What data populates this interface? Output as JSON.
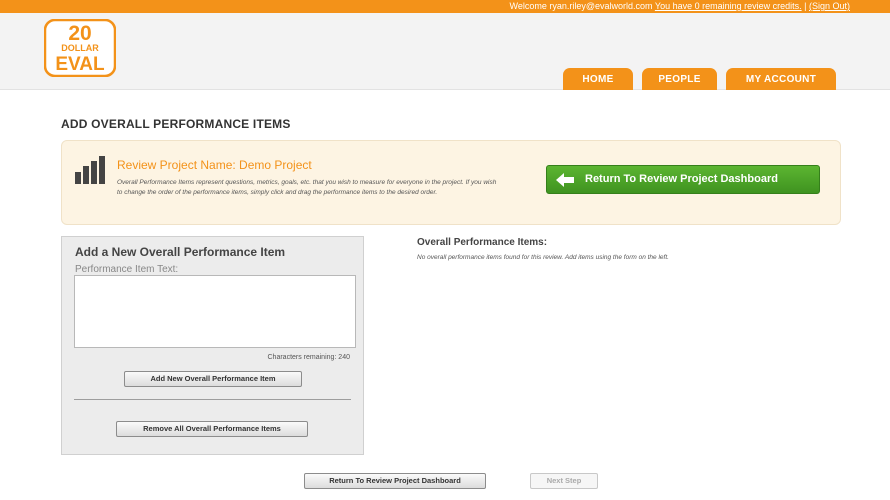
{
  "topbar": {
    "welcome_text": "Welcome ryan.riley@evalworld.com",
    "credits_link": "You have  0  remaining review credits.",
    "separator": " | ",
    "signout_link": "(Sign Out)"
  },
  "logo": {
    "line1": "20",
    "line2": "DOLLAR",
    "line3": "EVAL"
  },
  "nav": {
    "home": "HOME",
    "people": "PEOPLE",
    "account": "MY ACCOUNT"
  },
  "page": {
    "title": "ADD OVERALL PERFORMANCE ITEMS"
  },
  "project": {
    "name": "Review Project Name: Demo Project",
    "description": "Overall Performance Items represent questions, metrics, goals, etc. that you wish to measure for everyone in the project. If you wish to change the order of the performance items, simply click and drag the performance items to the desired order.",
    "return_button": "Return To Review Project Dashboard"
  },
  "form": {
    "title": "Add a New Overall Performance Item",
    "label": "Performance Item Text:",
    "value": "",
    "chars_remaining": "Characters remaining: 240",
    "add_button": "Add New Overall Performance Item",
    "remove_button": "Remove All Overall Performance Items"
  },
  "items": {
    "title": "Overall Performance Items:",
    "empty_text": "No overall performance items found for this review. Add items using the form on the left."
  },
  "footer": {
    "return_button": "Return To Review Project Dashboard",
    "next_button": "Next Step"
  },
  "colors": {
    "brand": "#f39219",
    "green": "#4aa427",
    "panel": "#ececec",
    "highlight": "#fdf4e3"
  }
}
